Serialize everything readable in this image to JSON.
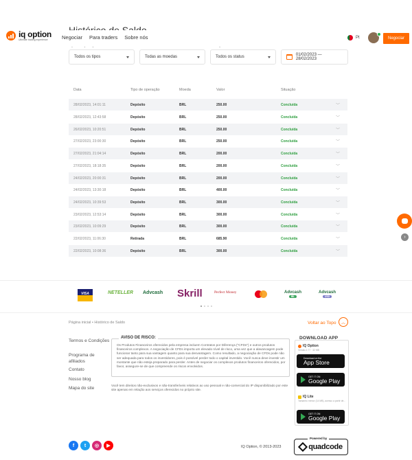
{
  "page": {
    "title": "Histórico de Saldo"
  },
  "header": {
    "logo_main": "iq option",
    "logo_sub": "Ultimate trading experience",
    "nav": [
      "Negociar",
      "Para traders",
      "Sobre nós"
    ],
    "lang": "Pt",
    "trade_button": "Negociar",
    "accent": "#ff6a00"
  },
  "filters": {
    "type": {
      "label": "Tipo de operação",
      "value": "Todos os tipos"
    },
    "currency": {
      "label": "Moeda",
      "value": "Todas as moedas"
    },
    "status": {
      "label": "Situação",
      "value": "Todos os status"
    },
    "date": {
      "label": "Data",
      "value": "01/02/2023 — 28/02/2023"
    }
  },
  "table": {
    "headers": [
      "Data",
      "Tipo de operação",
      "Moeda",
      "Valor",
      "Situação"
    ],
    "rows": [
      {
        "date": "28/02/2023, 14:01:11",
        "type": "Depósito",
        "currency": "BRL",
        "value": "250.00",
        "status": "Concluída"
      },
      {
        "date": "28/02/2023, 12:43:58",
        "type": "Depósito",
        "currency": "BRL",
        "value": "250.00",
        "status": "Concluída"
      },
      {
        "date": "26/02/2023, 10:20:51",
        "type": "Depósito",
        "currency": "BRL",
        "value": "250.00",
        "status": "Concluída"
      },
      {
        "date": "27/02/2023, 23:00:30",
        "type": "Depósito",
        "currency": "BRL",
        "value": "250.00",
        "status": "Concluída"
      },
      {
        "date": "27/02/2023, 21:04:14",
        "type": "Depósito",
        "currency": "BRL",
        "value": "200.00",
        "status": "Concluída"
      },
      {
        "date": "27/02/2023, 18:18:35",
        "type": "Depósito",
        "currency": "BRL",
        "value": "200.00",
        "status": "Concluída"
      },
      {
        "date": "24/02/2023, 20:00:31",
        "type": "Depósito",
        "currency": "BRL",
        "value": "200.00",
        "status": "Concluída"
      },
      {
        "date": "24/02/2023, 13:30:18",
        "type": "Depósito",
        "currency": "BRL",
        "value": "400.00",
        "status": "Concluída"
      },
      {
        "date": "24/02/2023, 10:39:53",
        "type": "Depósito",
        "currency": "BRL",
        "value": "300.00",
        "status": "Concluída"
      },
      {
        "date": "23/02/2023, 12:53:14",
        "type": "Depósito",
        "currency": "BRL",
        "value": "300.00",
        "status": "Concluída"
      },
      {
        "date": "23/02/2023, 10:09:29",
        "type": "Depósito",
        "currency": "BRL",
        "value": "300.00",
        "status": "Concluída"
      },
      {
        "date": "22/02/2023, 11:06:30",
        "type": "Retirada",
        "currency": "BRL",
        "value": "685.90",
        "status": "Concluída"
      },
      {
        "date": "22/02/2023, 10:08:36",
        "type": "Depósito",
        "currency": "BRL",
        "value": "300.00",
        "status": "Concluída"
      }
    ]
  },
  "payments": {
    "visa": "VISA",
    "neteller": "NETELLER",
    "advcash": "Advcash",
    "skrill": "Skrill",
    "perfect_money": "Perfect Money",
    "advcash_ibl": "Advcash",
    "advcash_ibl_badge": "IBL",
    "advcash_usd": "Advcash",
    "advcash_usd_badge": "USD"
  },
  "footer": {
    "breadcrumb": "Página inicial  •  Histórico de Saldo",
    "back_to_top": "Voltar ao Topo",
    "links": [
      "Termos e Condições",
      "Programa de afiliados",
      "Contato",
      "Nosso blog",
      "Mapa do site"
    ],
    "risk_title": "AVISO DE RISCO:",
    "risk_text": "Os Produtos Financeiros oferecidos pela empresa incluem Contratos por Diferença (\"CFDs\") e outros produtos financeiros complexos. A negociação de CFDs importa um elevado nível de risco, uma vez que a alavancagem pode funcionar tanto para sua vantagem quanto para sua desvantagem. Como resultado, a negociação de CFDs pode não ser adequada para todos os investidores, pois é possível perder todo o capital investido. Você nunca deve investir um montante que não esteja preparado para perder. Antes de negociar os complexos produtos financeiros oferecidos, por favor, assegure-se de que compreende os riscos envolvidos.",
    "legal_text": "Você tem direitos não-exclusivos e não-transferíveis relativos ao uso pessoal e não-comercial do IP disponibilizado por este site apenas em relação aos serviços oferecidos no próprio site.",
    "download_title": "DOWNLOAD APP",
    "app1_name": "IQ Option",
    "app1_sub": "Versão 2.77 · 32 MB",
    "app2_name": "IQ Lite",
    "app2_sub": "Tamanho menor (14 MB), acesso a partir de...",
    "appstore_small": "Download on the",
    "appstore_big": "App Store",
    "gplay_small": "GET IT ON",
    "gplay_big": "Google Play",
    "copyright": "IQ Option, © 2013-2023",
    "powered_by": "Powered by",
    "quadcode": "quadcode"
  }
}
